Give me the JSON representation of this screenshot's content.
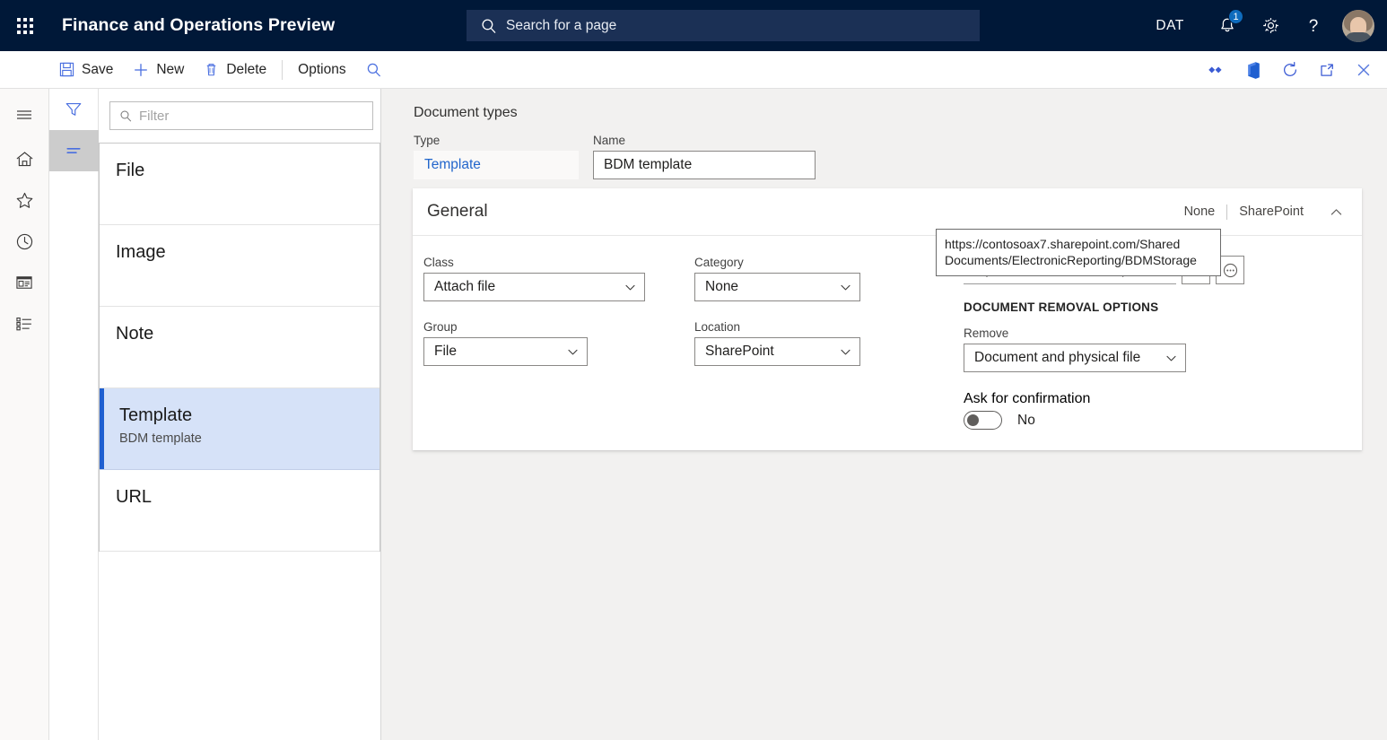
{
  "topbar": {
    "waffle_name": "app-launcher",
    "app_title": "Finance and Operations Preview",
    "search_placeholder": "Search for a page",
    "company": "DAT",
    "notification_count": "1"
  },
  "actionbar": {
    "save_label": "Save",
    "new_label": "New",
    "delete_label": "Delete",
    "options_label": "Options"
  },
  "rail": {
    "items": [
      {
        "name": "hamburger-menu-icon"
      },
      {
        "name": "home-icon"
      },
      {
        "name": "favorites-star-icon"
      },
      {
        "name": "recent-clock-icon"
      },
      {
        "name": "workspaces-icon"
      },
      {
        "name": "modules-list-icon"
      }
    ]
  },
  "filter_strip": {
    "items": [
      {
        "name": "filter-funnel-icon",
        "selected": false
      },
      {
        "name": "list-view-icon",
        "selected": true
      }
    ]
  },
  "list_panel": {
    "filter_placeholder": "Filter",
    "filter_value": "",
    "rows": [
      {
        "title": "File",
        "subtitle": "",
        "selected": false
      },
      {
        "title": "Image",
        "subtitle": "",
        "selected": false
      },
      {
        "title": "Note",
        "subtitle": "",
        "selected": false
      },
      {
        "title": "Template",
        "subtitle": "BDM template",
        "selected": true
      },
      {
        "title": "URL",
        "subtitle": "",
        "selected": false
      }
    ]
  },
  "main": {
    "page_heading": "Document types",
    "type_label": "Type",
    "type_value": "Template",
    "name_label": "Name",
    "name_value": "BDM template",
    "card": {
      "title": "General",
      "summary_left": "None",
      "summary_right": "SharePoint",
      "fields": {
        "class_label": "Class",
        "class_value": "Attach file",
        "category_label": "Category",
        "category_value": "None",
        "group_label": "Group",
        "group_value": "File",
        "location_label": "Location",
        "location_value": "SharePoint",
        "url_value": "https://contosoax7.sharepoint.c...",
        "removal_header": "DOCUMENT REMOVAL OPTIONS",
        "remove_label": "Remove",
        "remove_value": "Document and physical file",
        "confirm_label": "Ask for confirmation",
        "confirm_value": "No"
      }
    }
  },
  "tooltip": {
    "text": "https://contosoax7.sharepoint.com/Shared Documents/ElectronicReporting/BDMStorage"
  },
  "colors": {
    "nav_background": "#001838",
    "accent_blue": "#2266cc",
    "selected_row": "#d6e2f8",
    "selection_bar": "#1f5fd0",
    "content_background": "#f2f1f0",
    "icon_blue": "#4a6fe0"
  }
}
